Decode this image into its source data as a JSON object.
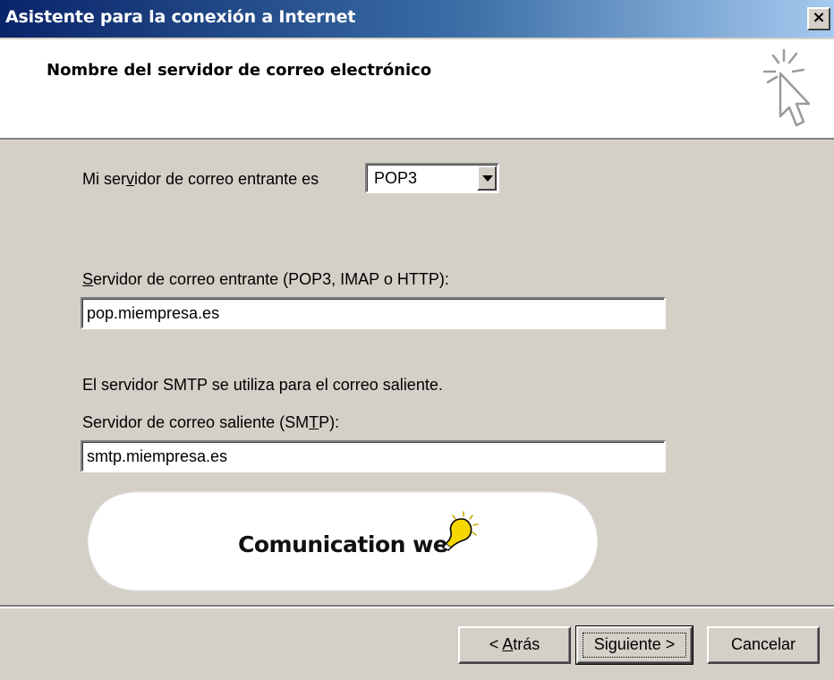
{
  "window": {
    "title": "Asistente para la conexión a Internet",
    "close_glyph": "×"
  },
  "header": {
    "title": "Nombre del servidor de correo electrónico",
    "icon": "wizard-cursor-icon"
  },
  "form": {
    "incoming_type_label_pre": "Mi ser",
    "incoming_type_label_mnemonic": "v",
    "incoming_type_label_post": "idor de correo entrante es",
    "incoming_type_value": "POP3",
    "incoming_server_label_pre": "",
    "incoming_server_label_mnemonic": "S",
    "incoming_server_label_post": "ervidor de correo entrante (POP3, IMAP o HTTP):",
    "incoming_server_value": "pop.miempresa.es",
    "smtp_note": "El servidor SMTP se utiliza para el correo saliente.",
    "outgoing_server_label_pre": "Servidor de correo saliente (SM",
    "outgoing_server_label_mnemonic": "T",
    "outgoing_server_label_post": "P):",
    "outgoing_server_value": "smtp.miempresa.es"
  },
  "logo": {
    "text": "Comunication we",
    "icon": "lightbulb-icon"
  },
  "buttons": {
    "back_pre": "< ",
    "back_mnemonic": "A",
    "back_post": "trás",
    "next": "Siguiente >",
    "cancel": "Cancelar"
  },
  "colors": {
    "title_gradient_start": "#0a246a",
    "title_gradient_end": "#a6caf0",
    "dialog_face": "#d4d0c8",
    "bulb_yellow": "#f7d700"
  }
}
